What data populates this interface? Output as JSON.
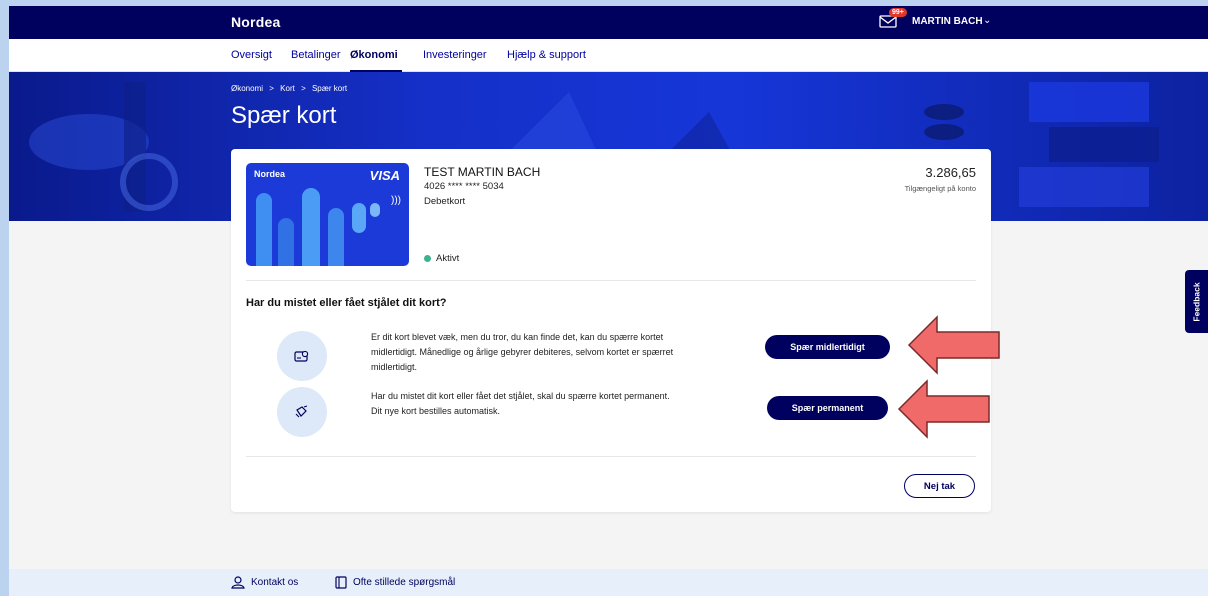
{
  "header": {
    "logo": "Nordea",
    "mail_badge": "99+",
    "user_name": "MARTIN BACH",
    "user_chevron": "⌄"
  },
  "nav": {
    "items": [
      {
        "label": "Oversigt",
        "active": false
      },
      {
        "label": "Betalinger",
        "active": false
      },
      {
        "label": "Økonomi",
        "active": true
      },
      {
        "label": "Investeringer",
        "active": false
      },
      {
        "label": "Hjælp & support",
        "active": false
      }
    ]
  },
  "breadcrumb": {
    "items": [
      "Økonomi",
      "Kort",
      "Spær kort"
    ],
    "separator": ">"
  },
  "page_title": "Spær kort",
  "card": {
    "brand": "Nordea",
    "network": "VISA",
    "holder": "TEST MARTIN BACH",
    "number": "4026 **** **** 5034",
    "type": "Debetkort",
    "status": "Aktivt",
    "amount": "3.286,65",
    "amount_label": "Tilgængeligt på konto"
  },
  "block": {
    "question": "Har du mistet eller fået stjålet dit kort?",
    "temporary_text": "Er dit kort blevet væk, men du tror, du kan finde det, kan du spærre kortet midlertidigt. Månedlige og årlige gebyrer debiteres, selvom kortet er spærret midlertidigt.",
    "temporary_button": "Spær midlertidigt",
    "permanent_text": "Har du mistet dit kort eller fået det stjålet, skal du spærre kortet permanent. Dit nye kort bestilles automatisk.",
    "permanent_button": "Spær permanent",
    "cancel_button": "Nej tak"
  },
  "feedback_label": "Feedback",
  "footer": {
    "contact": "Kontakt os",
    "faq": "Ofte stillede spørgsmål"
  },
  "colors": {
    "brand_navy": "#00005e",
    "hero_blue": "#1636d8",
    "status_green": "#3bb38e",
    "annotation_arrow": "#f06a6a"
  }
}
